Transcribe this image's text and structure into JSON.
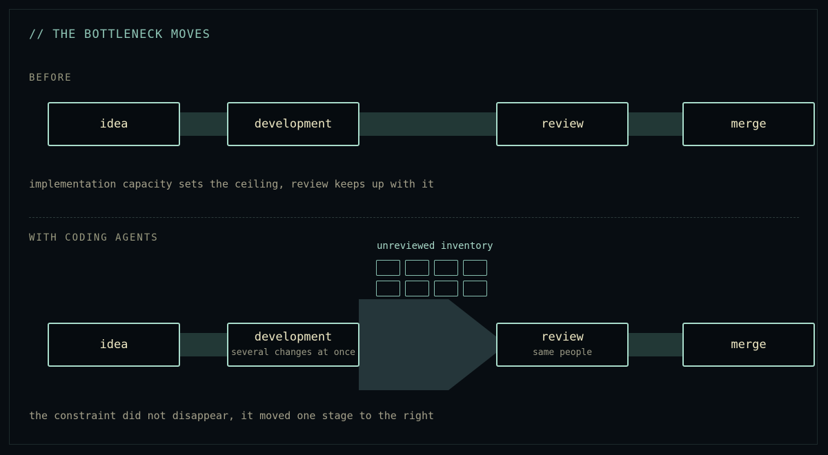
{
  "title": "// THE BOTTLENECK MOVES",
  "before": {
    "label": "BEFORE",
    "stages": [
      {
        "label": "idea"
      },
      {
        "label": "development"
      },
      {
        "label": "review"
      },
      {
        "label": "merge"
      }
    ],
    "caption": "implementation capacity sets the ceiling, review keeps up with it"
  },
  "after": {
    "label": "WITH CODING AGENTS",
    "inventory_label": "unreviewed inventory",
    "inventory_count": 8,
    "stages": [
      {
        "label": "idea"
      },
      {
        "label": "development",
        "sub": "several changes at once"
      },
      {
        "label": "review",
        "sub": "same people"
      },
      {
        "label": "merge"
      }
    ],
    "caption": "the constraint did not disappear, it moved one stage to the right"
  },
  "colors": {
    "background": "#080d12",
    "box_border": "#a9dccb",
    "box_text": "#efe9c4",
    "connector": "#223836",
    "funnel": "#25363a",
    "title": "#8ec5b5"
  }
}
